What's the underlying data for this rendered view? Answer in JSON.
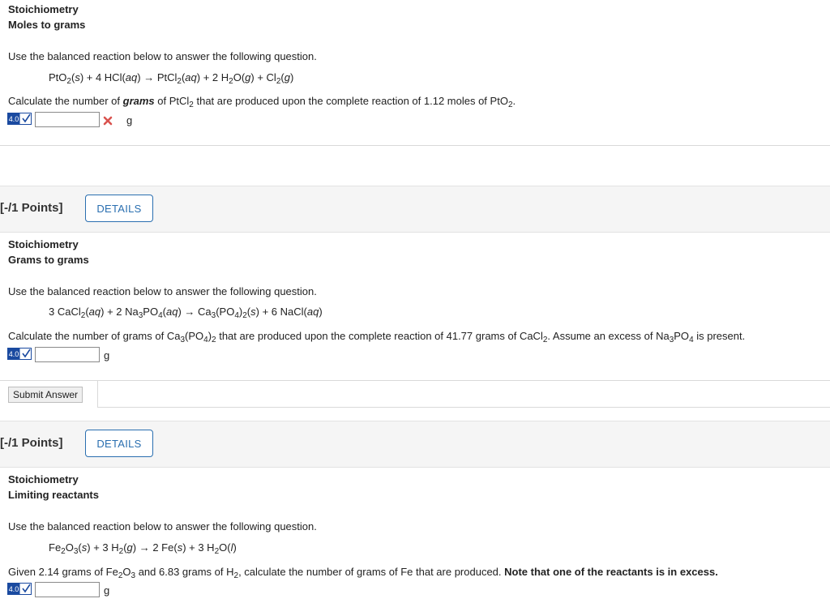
{
  "q1": {
    "topic": "Stoichiometry",
    "subtopic": "Moles to grams",
    "instruction": "Use the balanced reaction below to answer the following question.",
    "equation": {
      "p1": "PtO",
      "s1": "2",
      "t1": "(",
      "st1": "s",
      "t1b": ") + 4 HCl(",
      "st2": "aq",
      "t2": ") → PtCl",
      "s2": "2",
      "t3": "(",
      "st3": "aq",
      "t3b": ") + 2 H",
      "s3": "2",
      "t4": "O(",
      "st4": "g",
      "t4b": ") + Cl",
      "s4": "2",
      "t5": "(",
      "st5": "g",
      "t5b": ")"
    },
    "question": {
      "a": "Calculate the number of ",
      "b": "grams",
      "c": " of PtCl",
      "s1": "2",
      "d": " that are produced upon the complete reaction of 1.12 moles of PtO",
      "s2": "2",
      "e": "."
    },
    "answer_value": "",
    "status_icon": "x-icon",
    "unit": "g",
    "badge_text": "4.0"
  },
  "q2": {
    "points": "[-/1 Points]",
    "details_label": "DETAILS",
    "topic": "Stoichiometry",
    "subtopic": "Grams to grams",
    "instruction": "Use the balanced reaction below to answer the following question.",
    "equation": {
      "a": "3 CaCl",
      "s1": "2",
      "b": "(",
      "i1": "aq",
      "c": ") + 2 Na",
      "s2": "3",
      "d": "PO",
      "s3": "4",
      "e": "(",
      "i2": "aq",
      "f": ") → Ca",
      "s4": "3",
      "g": "(PO",
      "s5": "4",
      "h": ")",
      "s6": "2",
      "i": "(",
      "i3": "s",
      "j": ") + 6 NaCl(",
      "i4": "aq",
      "k": ")"
    },
    "question": {
      "a": "Calculate the number of grams of Ca",
      "s1": "3",
      "b": "(PO",
      "s2": "4",
      "c": ")",
      "s3": "2",
      "d": " that are produced upon the complete reaction of 41.77 grams of CaCl",
      "s4": "2",
      "e": ". Assume an excess of Na",
      "s5": "3",
      "f": "PO",
      "s6": "4",
      "g": " is present."
    },
    "answer_value": "",
    "unit": "g",
    "badge_text": "4.0",
    "submit_label": "Submit Answer"
  },
  "q3": {
    "points": "[-/1 Points]",
    "details_label": "DETAILS",
    "topic": "Stoichiometry",
    "subtopic": "Limiting reactants",
    "instruction": "Use the balanced reaction below to answer the following question.",
    "equation": {
      "a": "Fe",
      "s1": "2",
      "b": "O",
      "s2": "3",
      "c": "(",
      "i1": "s",
      "d": ") + 3 H",
      "s3": "2",
      "e": "(",
      "i2": "g",
      "f": ") → 2 Fe(",
      "i3": "s",
      "g": ") + 3 H",
      "s4": "2",
      "h": "O(",
      "i4": "l",
      "k": ")"
    },
    "question": {
      "a": "Given 2.14 grams of Fe",
      "s1": "2",
      "b": "O",
      "s2": "3",
      "c": " and 6.83 grams of H",
      "s3": "2",
      "d": ", calculate the number of grams of Fe that are produced. ",
      "note": "Note that one of the reactants is in excess."
    },
    "answer_value": "",
    "unit": "g",
    "badge_text": "4.0"
  },
  "colors": {
    "accent": "#2a6fb0",
    "badge_blue": "#1a4aa0",
    "error_red": "#d9534f",
    "bar_bg": "#f5f5f5"
  }
}
